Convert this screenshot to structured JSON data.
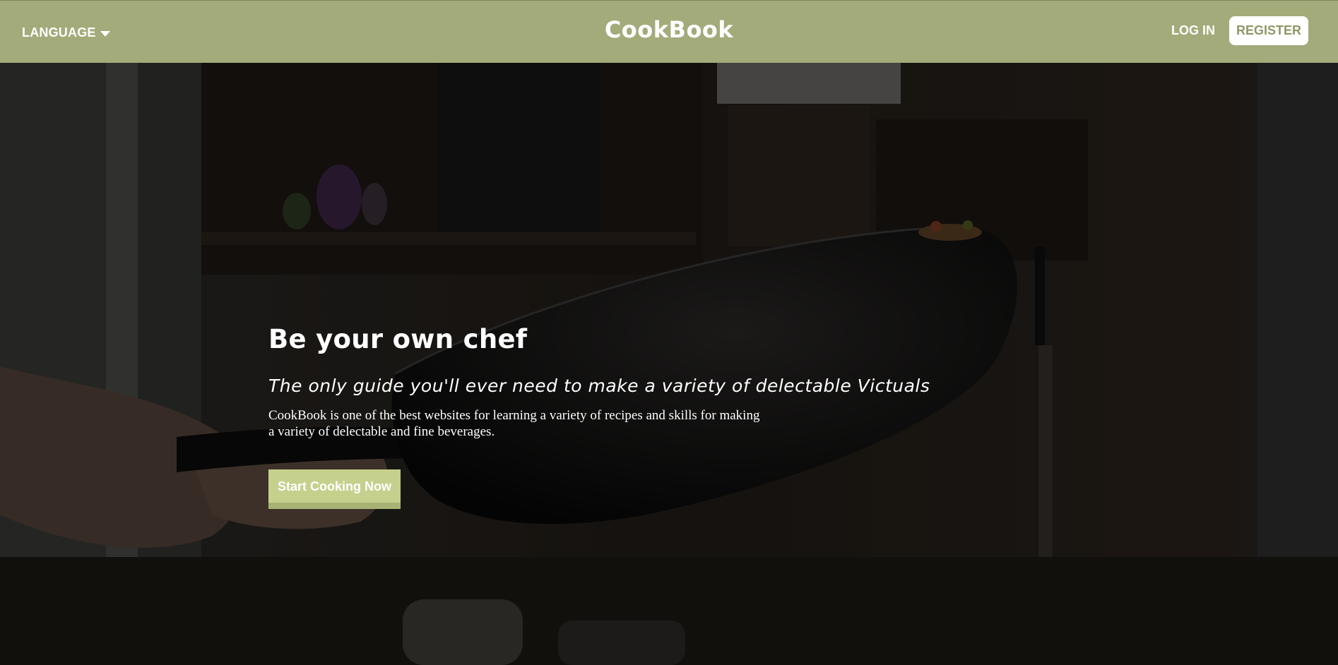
{
  "navbar": {
    "language_label": "LANGUAGE",
    "brand": "CookBook",
    "login_label": "LOG IN",
    "register_label": "REGISTER",
    "background_color": "#a3ab7a"
  },
  "hero": {
    "title": "Be your own chef",
    "subtitle": "The only guide you'll ever need to make a variety of delectable Victuals",
    "description": "CookBook is one of the best websites for learning a variety of recipes and skills for making a variety of delectable and fine beverages.",
    "cta_label": "Start Cooking Now",
    "cta_color": "#c6d08d"
  }
}
